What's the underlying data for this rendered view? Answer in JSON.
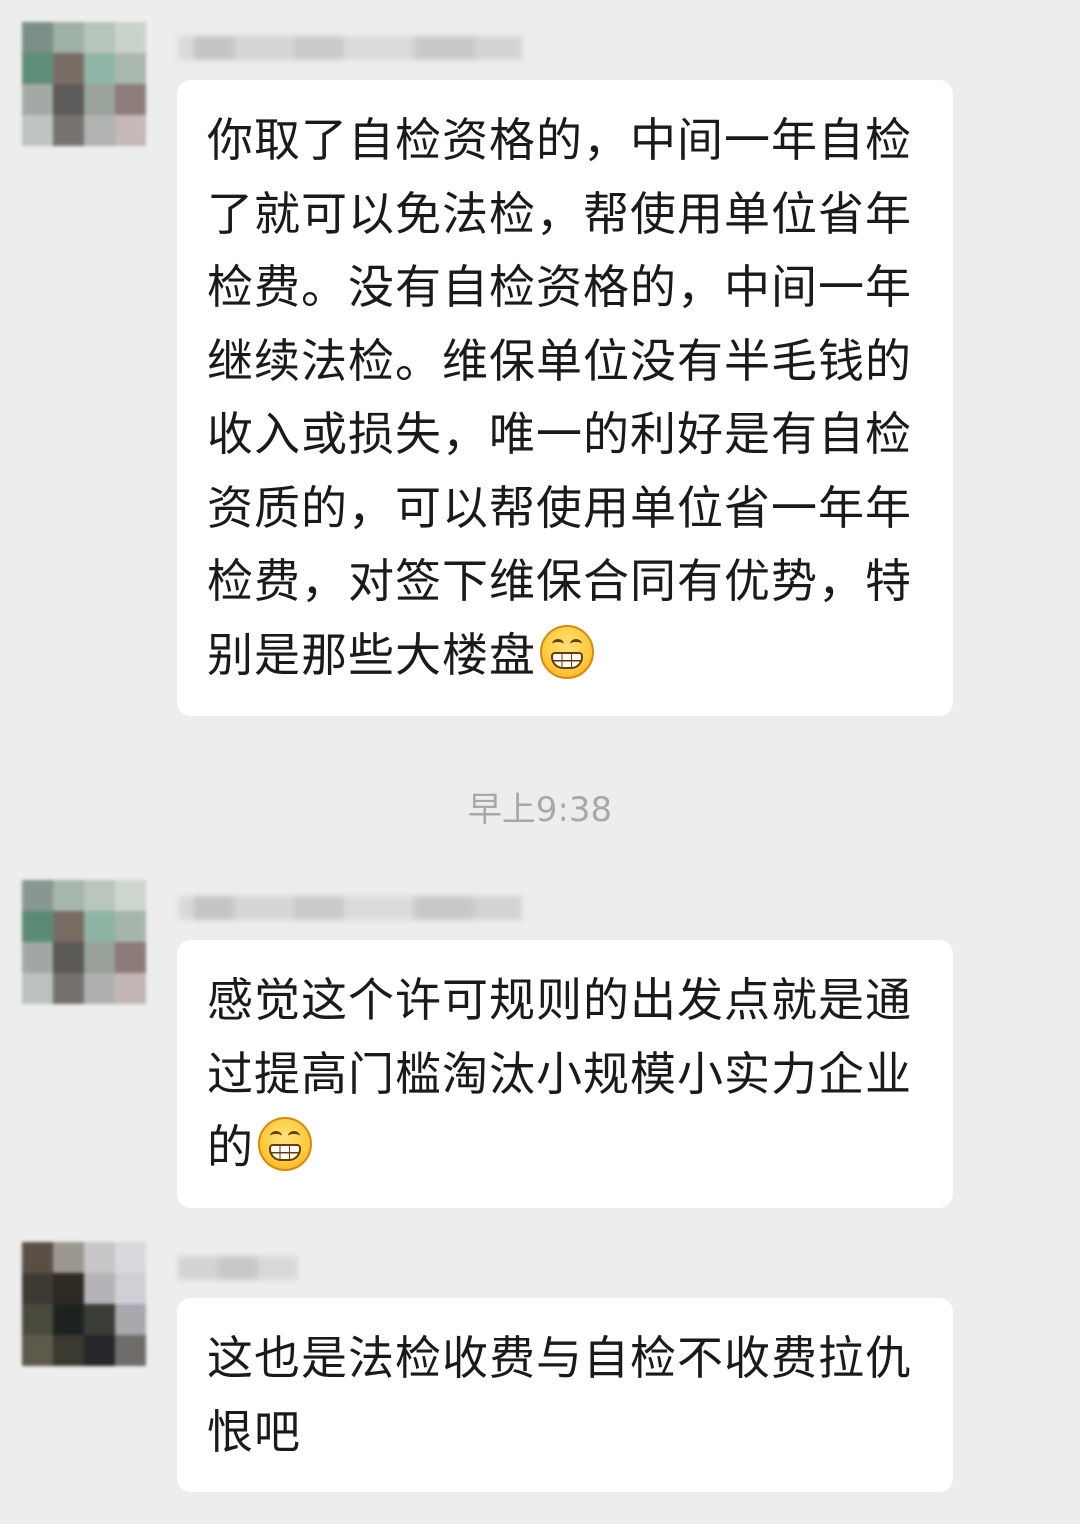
{
  "messages": [
    {
      "text": "你取了自检资格的，中间一年自检了就可以免法检，帮使用单位省年检费。没有自检资格的，中间一年继续法检。维保单位没有半毛钱的收入或损失，唯一的利好是有自检资质的，可以帮使用单位省一年年检费，对签下维保合同有优势，特别是那些大楼盘",
      "emoji": "grin-emoji"
    },
    {
      "text": "感觉这个许可规则的出发点就是通过提高门槛淘汰小规模小实力企业的",
      "emoji": "grimace-emoji"
    },
    {
      "text": "这也是法检收费与自检不收费拉仇恨吧",
      "emoji": ""
    }
  ],
  "timestamp": "早上9:38",
  "colors": {
    "background": "#ededed",
    "bubble": "#ffffff",
    "timestamp": "#a8a8a8"
  }
}
